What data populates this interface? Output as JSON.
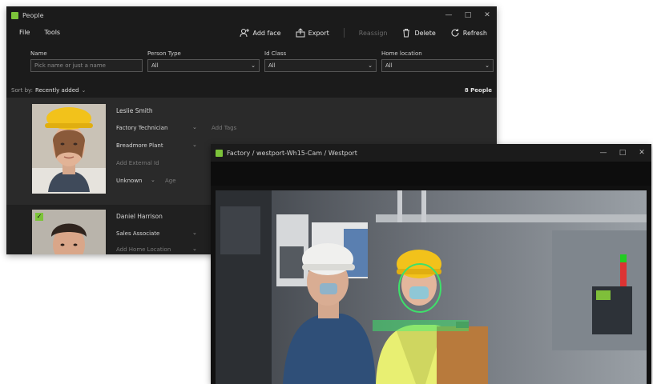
{
  "people_window": {
    "title": "People",
    "menu": [
      "File",
      "Tools"
    ],
    "toolbar": {
      "add_face": "Add face",
      "export": "Export",
      "reassign": "Reassign",
      "delete": "Delete",
      "refresh": "Refresh"
    },
    "filters": {
      "name_label": "Name",
      "name_placeholder": "Pick name or just a name",
      "person_type_label": "Person Type",
      "person_type_value": "All",
      "id_class_label": "Id Class",
      "id_class_value": "All",
      "home_location_label": "Home location",
      "home_location_value": "All"
    },
    "sort": {
      "label": "Sort by:",
      "value": "Recently added",
      "count": "8 People"
    },
    "people": [
      {
        "name": "Leslie Smith",
        "role": "Factory Technician",
        "location": "Breadmore Plant",
        "add_external_id": "Add External Id",
        "status": "Unknown",
        "age_label": "Age",
        "add_tags": "Add Tags"
      },
      {
        "name": "Daniel Harrison",
        "role": "Sales Associate",
        "add_home_location": "Add Home Location"
      }
    ]
  },
  "video_window": {
    "title": "Factory / westport-Wh15-Cam / Westport"
  },
  "colors": {
    "accent": "#7cc33a",
    "detection": "#3ee06a"
  },
  "icons": [
    "app-icon",
    "add-face-icon",
    "export-icon",
    "delete-icon",
    "refresh-icon",
    "chevron-down-icon",
    "checkbox-icon"
  ]
}
